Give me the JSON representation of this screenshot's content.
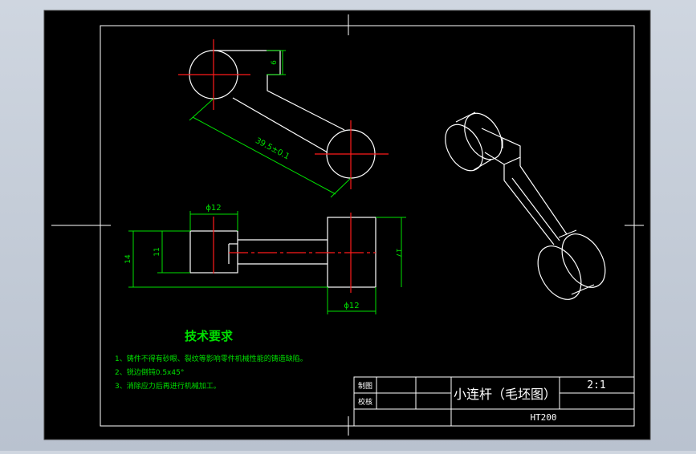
{
  "drawing": {
    "title": "小连杆（毛坯图）",
    "scale": "2:1",
    "material": "HT200",
    "title_block": {
      "drawn_label": "制图",
      "checked_label": "校核"
    },
    "dimensions": {
      "offset_6": "6",
      "center_distance": "39.5±0.1",
      "dia_top": "ϕ12",
      "dia_bottom": "ϕ12",
      "height_14": "14",
      "height_11": "11",
      "height_17": "17"
    },
    "notes": {
      "heading": "技术要求",
      "items": [
        "1、铸件不得有砂眼、裂纹等影响零件机械性能的铸造缺陷。",
        "2、锐边倒钝0.5x45°",
        "3、消除应力后再进行机械加工。"
      ]
    },
    "colors": {
      "paper": "#000000",
      "outline": "#ffffff",
      "centerline": "#ff1a1a",
      "dimension": "#00e000",
      "viewport_bg": "#cfd6e0",
      "frame": "#dddddd"
    }
  }
}
